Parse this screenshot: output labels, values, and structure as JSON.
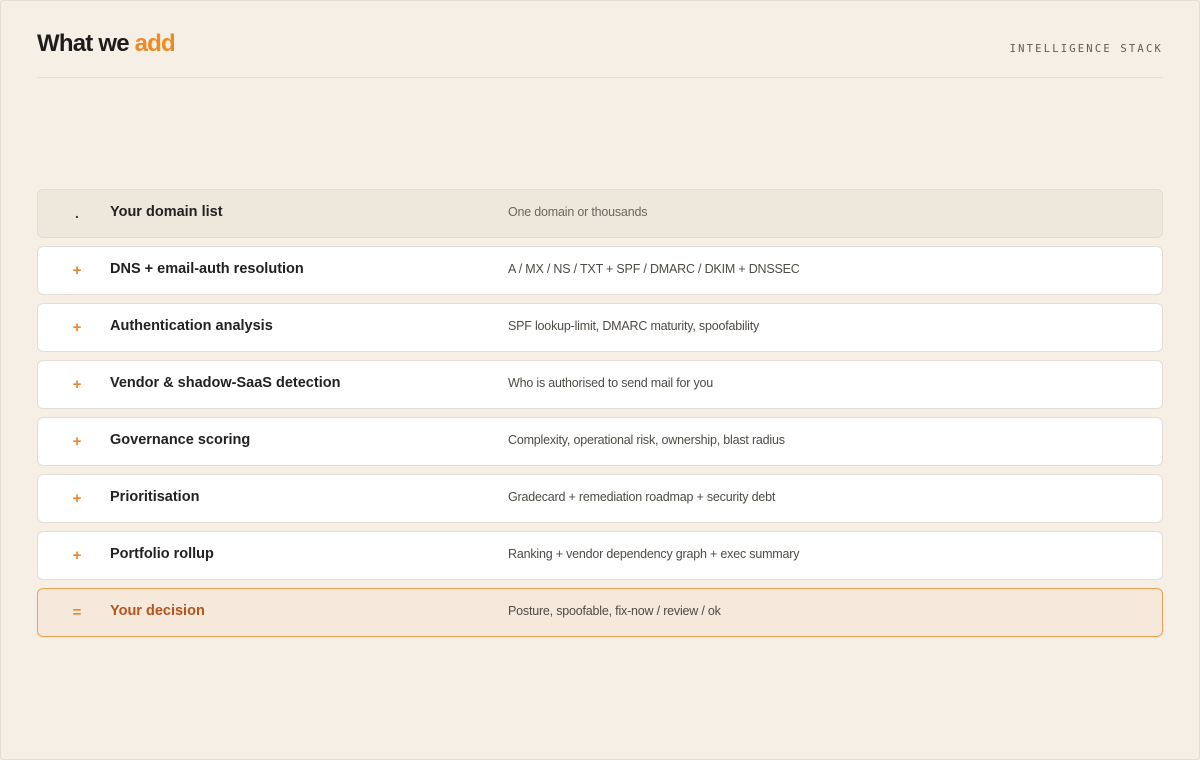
{
  "header": {
    "title_main": "What we",
    "title_accent": "add",
    "kicker": "INTELLIGENCE STACK"
  },
  "colors": {
    "accent": "#f08a24",
    "background": "#f5efe5",
    "output_text": "#b5541b"
  },
  "rows": [
    {
      "symbol": ".",
      "label": "Your domain list",
      "description": "One domain or thousands"
    },
    {
      "symbol": "+",
      "label": "DNS + email-auth resolution",
      "description": "A / MX / NS / TXT + SPF / DMARC / DKIM + DNSSEC"
    },
    {
      "symbol": "+",
      "label": "Authentication analysis",
      "description": "SPF lookup-limit, DMARC maturity, spoofability"
    },
    {
      "symbol": "+",
      "label": "Vendor & shadow-SaaS detection",
      "description": "Who is authorised to send mail for you"
    },
    {
      "symbol": "+",
      "label": "Governance scoring",
      "description": "Complexity, operational risk, ownership, blast radius"
    },
    {
      "symbol": "+",
      "label": "Prioritisation",
      "description": "Gradecard + remediation roadmap + security debt"
    },
    {
      "symbol": "+",
      "label": "Portfolio rollup",
      "description": "Ranking + vendor dependency graph + exec summary"
    },
    {
      "symbol": "=",
      "label": "Your decision",
      "description": "Posture, spoofable, fix-now / review / ok"
    }
  ]
}
